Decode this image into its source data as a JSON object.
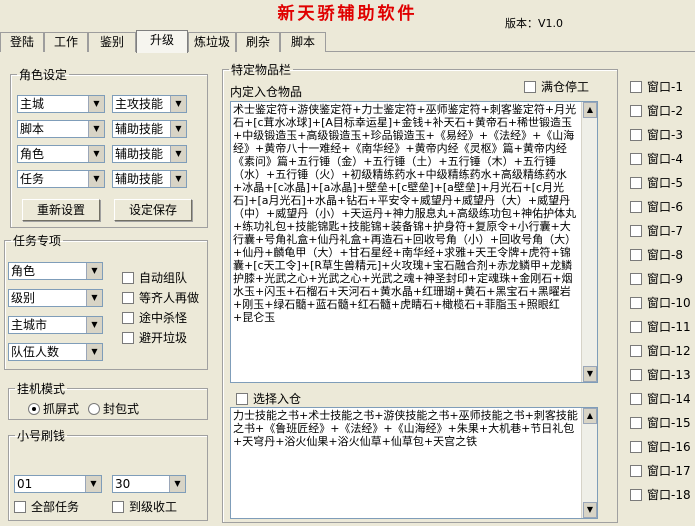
{
  "app": {
    "title": "新天骄辅助软件",
    "version": "版本：V1.0"
  },
  "tabs": [
    "登陆",
    "工作",
    "鉴别",
    "升级",
    "炼垃圾",
    "刷杂",
    "脚本"
  ],
  "role_settings": {
    "legend": "角色设定",
    "selects": [
      "主城",
      "主攻技能",
      "脚本",
      "辅助技能",
      "角色",
      "辅助技能",
      "任务",
      "辅助技能"
    ],
    "reset_button": "重新设置",
    "save_button": "设定保存"
  },
  "task_items": {
    "legend": "任务专项",
    "selects": [
      "角色",
      "级别",
      "主城市",
      "队伍人数"
    ],
    "checks": [
      "自动组队",
      "等齐人再做",
      "途中杀怪",
      "避开垃圾"
    ]
  },
  "idle_mode": {
    "legend": "挂机模式",
    "options": [
      "抓屏式",
      "封包式"
    ],
    "selected": "抓屏式"
  },
  "alt_money": {
    "legend": "小号刷钱",
    "select1": "01",
    "select2": "30",
    "checks": [
      "全部任务",
      "到级收工"
    ]
  },
  "special_items": {
    "legend": "特定物品栏",
    "store_label": "内定入仓物品",
    "full_stop": "满仓停工",
    "store_text": "术士鉴定符+游侠鉴定符+力士鉴定符+巫师鉴定符+刺客鉴定符+月光石+[c茸水冰球]+[A目标幸运星]+金钱+补天石+黄帝石+稀世锻造玉+中级锻造玉+高级锻造玉+珍品锻造玉+《易经》+《法经》+《山海经》+黄帝八十一难经+《南华经》+黄帝内经《灵枢》篇+黄帝内经《素问》篇+五行锤（金）+五行锤（土）+五行锤（木）+五行锤（水）+五行锤（火）+初级精练药水+中级精练药水+高级精练药水+冰晶+[c冰晶]+[a冰晶]+壁垒+[c壁垒]+[a壁垒]+月光石+[c月光石]+[a月光石]+水晶+钻石+平安令+威望丹+威望丹（大）+威望丹（中）+威望丹（小）+天运丹+神力服息丸+高级练功包+神佑护体丸+练功礼包+技能锦匙+技能锦+装备锦+护身符+复原令+小行囊+大行囊+号角礼盒+仙丹礼盒+再造石+回收号角（小）+回收号角（大）+仙丹+麟龟甲（大）+甘石星经+南华经+求雅+天王令牌+虎符+锦囊+[c天工令]+[R草生兽精元]+火攻瑰+宝石融合剂+赤龙鳞甲+龙鳞护膝+光武之心+光武之心+光武之魂+神圣封印+定魂珠+金刚石+烟水玉+闪玉+石榴石+天河石+黄水晶+红珊瑚+黄石+黑宝石+黑曜岩+刚玉+绿石髓+蓝石髓+红石髓+虎睛石+橄榄石+菲脂玉+照眼红+昆仑玉",
    "choose_label": "选择入仓",
    "choose_text": "力士技能之书+术士技能之书+游侠技能之书+巫师技能之书+刺客技能之书+《鲁班匠经》+《法经》+《山海经》+朱果+大机巷+节日礼包+天穹丹+浴火仙果+浴火仙草+仙草包+天宫之铁"
  },
  "windows": [
    "窗口-1",
    "窗口-2",
    "窗口-3",
    "窗口-4",
    "窗口-5",
    "窗口-6",
    "窗口-7",
    "窗口-8",
    "窗口-9",
    "窗口-10",
    "窗口-11",
    "窗口-12",
    "窗口-13",
    "窗口-14",
    "窗口-15",
    "窗口-16",
    "窗口-17",
    "窗口-18"
  ]
}
